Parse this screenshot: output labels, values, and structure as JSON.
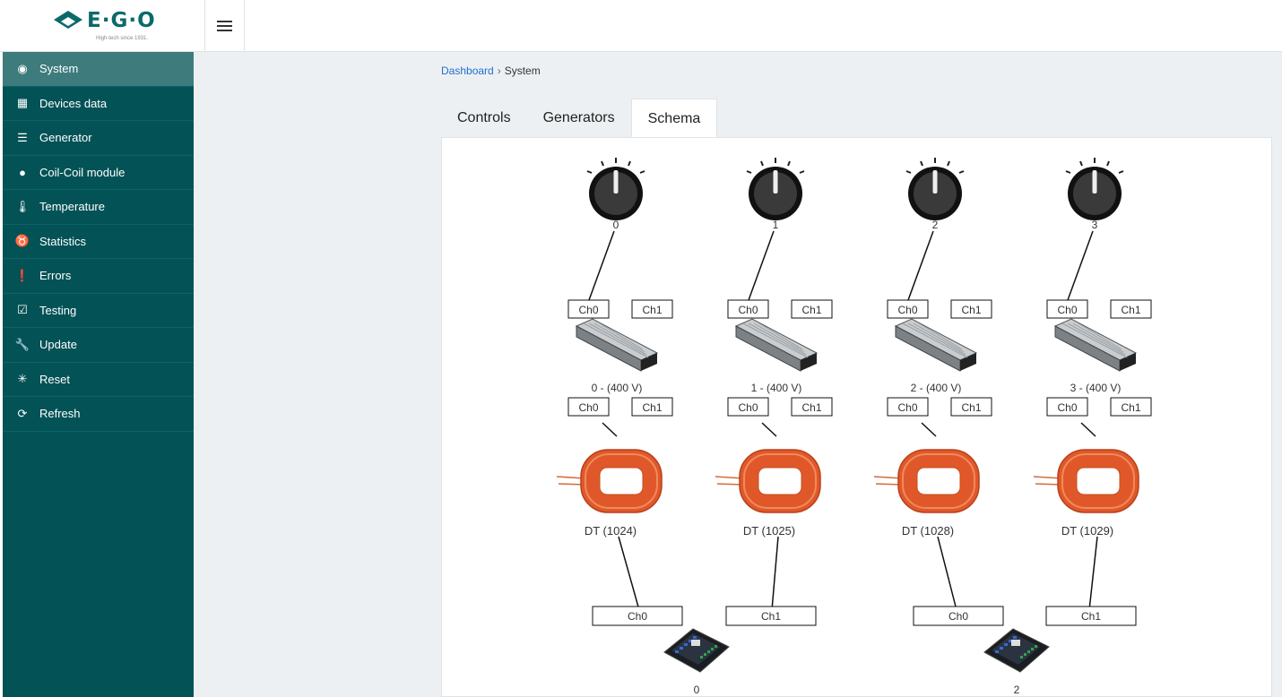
{
  "brand": {
    "name": "E·G·O",
    "tagline": "High-tech since 1931."
  },
  "sidebar": {
    "items": [
      {
        "label": "System",
        "icon": "dashboard-gauge-icon",
        "active": true
      },
      {
        "label": "Devices data",
        "icon": "table-icon"
      },
      {
        "label": "Generator",
        "icon": "sliders-icon"
      },
      {
        "label": "Coil-Coil module",
        "icon": "circle-icon"
      },
      {
        "label": "Temperature",
        "icon": "thermometer-icon"
      },
      {
        "label": "Statistics",
        "icon": "stethoscope-icon"
      },
      {
        "label": "Errors",
        "icon": "exclamation-circle-icon"
      },
      {
        "label": "Testing",
        "icon": "checkbox-icon"
      },
      {
        "label": "Update",
        "icon": "wrench-icon"
      },
      {
        "label": "Reset",
        "icon": "spinner-icon"
      },
      {
        "label": "Refresh",
        "icon": "refresh-icon"
      }
    ]
  },
  "breadcrumb": {
    "root": "Dashboard",
    "separator": "›",
    "current": "System"
  },
  "tabs": [
    {
      "label": "Controls"
    },
    {
      "label": "Generators"
    },
    {
      "label": "Schema",
      "active": true
    }
  ],
  "schema": {
    "knobs": [
      "0",
      "1",
      "2",
      "3"
    ],
    "generators": [
      "0 - (400 V)",
      "1 - (400 V)",
      "2 - (400 V)",
      "3 - (400 V)"
    ],
    "channel_labels": [
      "Ch0",
      "Ch1"
    ],
    "coils": [
      "DT (1024)",
      "DT (1025)",
      "DT (1028)",
      "DT (1029)"
    ],
    "module_channels": [
      "Ch0",
      "Ch1",
      "Ch0",
      "Ch1"
    ],
    "modules": [
      "0",
      "2"
    ]
  },
  "colors": {
    "sidebar_bg": "#035256",
    "sidebar_active": "#3d7b7c",
    "accent": "#0a6a6a",
    "coil": "#e0582a"
  }
}
